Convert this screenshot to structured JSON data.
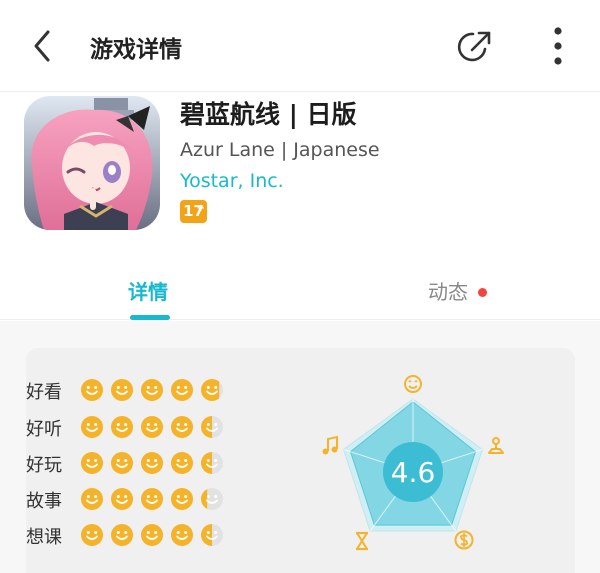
{
  "header": {
    "title": "游戏详情",
    "icons": {
      "back": "chevron-left-icon",
      "share": "share-icon",
      "more": "more-vertical-icon"
    }
  },
  "game": {
    "name": "碧蓝航线 | 日版",
    "subtitle": "Azur Lane | Japanese",
    "publisher": "Yostar, Inc.",
    "age_rating": "17",
    "age_rating_plus": "+"
  },
  "tabs": [
    {
      "label": "详情",
      "active": true
    },
    {
      "label": "动态",
      "active": false,
      "has_notification": true
    }
  ],
  "ratings": {
    "overall": "4.6",
    "categories": [
      {
        "label": "好看",
        "value": 4.8
      },
      {
        "label": "好听",
        "value": 4.5
      },
      {
        "label": "好玩",
        "value": 4.5
      },
      {
        "label": "故事",
        "value": 4.3
      },
      {
        "label": "想课",
        "value": 4.5
      }
    ],
    "radar_axes": [
      {
        "icon": "smile-icon",
        "value": 4.8
      },
      {
        "icon": "joystick-icon",
        "value": 4.5
      },
      {
        "icon": "dollar-icon",
        "value": 4.5
      },
      {
        "icon": "hourglass-icon",
        "value": 4.5
      },
      {
        "icon": "music-note-icon",
        "value": 4.5
      }
    ]
  },
  "colors": {
    "accent": "#17b9cf",
    "face_yellow": "#f5b32a",
    "notify_red": "#f0443f",
    "age_badge": "#f2a317"
  }
}
